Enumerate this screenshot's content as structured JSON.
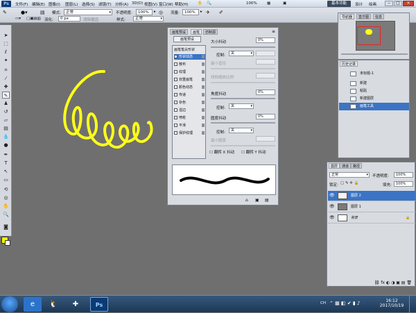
{
  "menubar": {
    "logo": "Ps",
    "items": [
      "文件(F)",
      "编辑(E)",
      "图像(I)",
      "图层(L)",
      "选择(S)",
      "滤镜(T)",
      "分析(A)",
      "3D(D)",
      "视图(V)",
      "窗口(W)",
      "帮助(H)"
    ],
    "zoom": "100%",
    "workspaces": [
      "基本功能",
      "设计",
      "绘画",
      "更多"
    ],
    "active_workspace": "基本功能"
  },
  "options_bar": {
    "mode_label": "模式:",
    "mode_value": "正常",
    "opacity_label": "不透明度:",
    "opacity_value": "100%",
    "flow_label": "流量:",
    "flow_value": "100%",
    "row2": {
      "feather_label": "羽化:",
      "feather_value": "0 px",
      "antialias_label": "消除锯齿",
      "style_label": "样式:",
      "style_value": "正常"
    }
  },
  "brush_panel": {
    "tabs": [
      "画笔预设",
      "画笔",
      "仿制源"
    ],
    "active_tab": "画笔",
    "presets_button": "画笔预设",
    "list_header": "画笔笔尖形状",
    "list_items": [
      "形状动态",
      "散布",
      "纹理",
      "双重画笔",
      "颜色动态",
      "传递",
      "杂色",
      "湿边",
      "喷枪",
      "平滑",
      "保护纹理"
    ],
    "active_item": "形状动态",
    "size_jitter_label": "大小抖动",
    "size_jitter_value": "0%",
    "control_label": "控制:",
    "control_value": "关",
    "min_diameter_label": "最小直径",
    "tilt_scale_label": "倾斜缩放比例",
    "angle_jitter_label": "角度抖动",
    "angle_jitter_value": "0%",
    "roundness_jitter_label": "圆度抖动",
    "roundness_jitter_value": "0%",
    "min_roundness_label": "最小圆度",
    "flip_x_label": "翻转 X 抖动",
    "flip_y_label": "翻转 Y 抖动"
  },
  "navigator": {
    "tabs": [
      "导航器",
      "直方图",
      "信息"
    ]
  },
  "history": {
    "tabs": [
      "历史记录"
    ],
    "snapshot": "未标题-1",
    "items": [
      "新建",
      "粘贴",
      "新建图层",
      "画笔工具"
    ],
    "active_item": "画笔工具"
  },
  "layers": {
    "tabs": [
      "图层",
      "通道",
      "路径"
    ],
    "blend_mode": "正常",
    "opacity_label": "不透明度:",
    "opacity_value": "100%",
    "lock_label": "锁定:",
    "fill_label": "填充:",
    "fill_value": "100%",
    "rows": [
      {
        "name": "图层 2",
        "active": true
      },
      {
        "name": "图层 1",
        "active": false
      },
      {
        "name": "背景",
        "active": false
      }
    ]
  },
  "taskbar": {
    "lang": "CH",
    "time": "16:12",
    "date": "2017/10/19"
  },
  "colors": {
    "foreground": "#ffff00",
    "stroke": "#ffff1a",
    "selection": "#3b74c4"
  }
}
